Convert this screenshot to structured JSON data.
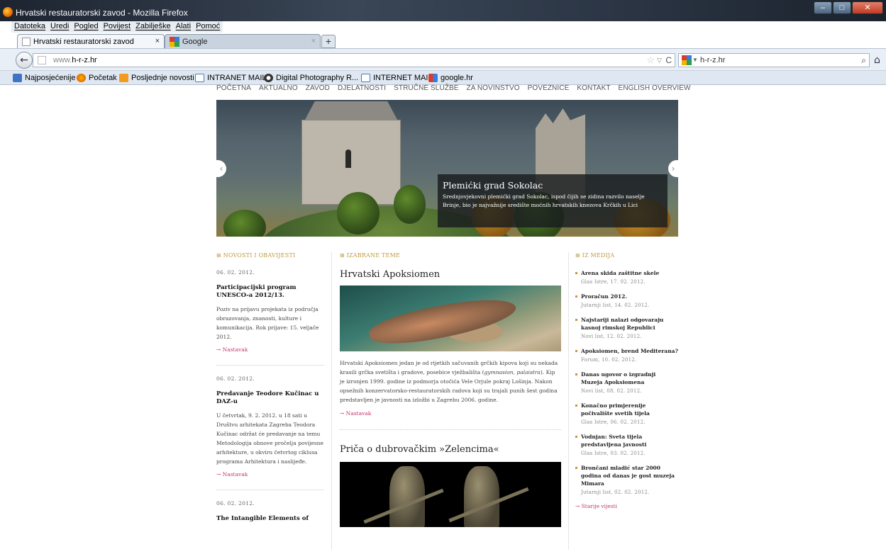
{
  "window": {
    "title": "Hrvatski restauratorski zavod - Mozilla Firefox"
  },
  "menu": [
    "Datoteka",
    "Uredi",
    "Pogled",
    "Povijest",
    "Zabilješke",
    "Alati",
    "Pomoć"
  ],
  "tabs": [
    {
      "label": "Hrvatski restauratorski zavod",
      "close": "×"
    },
    {
      "label": "Google",
      "close": "×"
    }
  ],
  "newtab": "+",
  "nav": {
    "url_prefix": "www.",
    "url_host": "h-r-z.hr",
    "search_value": "h-r-z.hr"
  },
  "bookmarks": [
    {
      "label": "Najposjećenije"
    },
    {
      "label": "Početak"
    },
    {
      "label": "Posljednje novosti"
    },
    {
      "label": "INTRANET MAIL"
    },
    {
      "label": "Digital Photography R..."
    },
    {
      "label": "INTERNET MAIL"
    },
    {
      "label": "google.hr"
    }
  ],
  "sitenav": [
    "POČETNA",
    "AKTUALNO",
    "ZAVOD",
    "DJELATNOSTI",
    "STRUČNE SLUŽBE",
    "ZA NOVINSTVO",
    "POVEZNICE",
    "KONTAKT",
    "ENGLISH OVERVIEW"
  ],
  "hero": {
    "caption_title": "Plemićki grad Sokolac",
    "caption_text": "Srednjovjekovni plemićki grad Sokolac, ispod čijih se zidina razvilo naselje Brinje, bio je najvažnije središte moćnih hrvatskih knezova Krčkih u Lici"
  },
  "sections": {
    "left": "NOVOSTI I OBAVIJESTI",
    "mid": "IZABRANE TEME",
    "right": "IZ MEDIJA"
  },
  "news": [
    {
      "date": "06. 02. 2012.",
      "title": "Participacijski program UNESCO-a 2012/13.",
      "body": "Poziv na prijavu projekata iz područja obrazovanja, znanosti, kulture i komunikacija. Rok prijave: 15. veljače 2012.",
      "more": "→ Nastavak"
    },
    {
      "date": "06. 02. 2012.",
      "title": "Predavanje Teodore Kučinac u DAZ-u",
      "body": "U četvrtak, 9. 2. 2012. u 18 sati u Društvu arhitekata Zagreba Teodora Kučinac održat će predavanje na temu Metodologija obnove pročelja povijesne arhitekture, u okviru četvrtog ciklusa programa Arhitektura i naslijeđe.",
      "more": "→ Nastavak"
    },
    {
      "date": "06. 02. 2012.",
      "title": "The Intangible Elements of",
      "body": "",
      "more": ""
    }
  ],
  "features": [
    {
      "title": "Hrvatski Apoksiomen",
      "body_1": "Hrvatski Apoksiomen jedan je od rijetkih sačuvanih grčkih kipova koji su nekada krasili grčka svetišta i gradove, posebice vježbališta (",
      "body_em1": "gymnasion",
      "body_2": ", ",
      "body_em2": "palaistra",
      "body_3": "). Kip je izronjen 1999. godine iz podmorja otočića Vele Orjule pokraj Lošinja. Nakon opsežnih konzervatorsko-restauratorskih radova koji su trajali punih šest godina predstavljen je javnosti na izložbi u Zagrebu 2006. godine.",
      "more": "→ Nastavak"
    },
    {
      "title": "Priča o dubrovačkim »Zelencima«"
    }
  ],
  "media": [
    {
      "title": "Arena skida zaštitne skele",
      "source": "Glas Istre, 17. 02. 2012."
    },
    {
      "title": "Proračun 2012.",
      "source": "Jutarnji list, 14. 02. 2012."
    },
    {
      "title": "Najstariji nalazi odgovaraju kasnoj rimskoj Republici",
      "source": "Novi list, 12. 02. 2012."
    },
    {
      "title": "Apoksiomen, brend Mediterana?",
      "source": "Forum, 10. 02. 2012."
    },
    {
      "title": "Danas ugovor o izgradnji Muzeja Apoksiomena",
      "source": "Novi list, 08. 02. 2012."
    },
    {
      "title": "Konačno primjerenije počivalište svetih tijela",
      "source": "Glas Istre, 06. 02. 2012."
    },
    {
      "title": "Vodnjan: Sveta tijela predstavljena javnosti",
      "source": "Glas Istre, 03. 02. 2012."
    },
    {
      "title": "Brončani mladić star 2000 godina od danas je gost muzeja Mimara",
      "source": "Jutarnji list, 02. 02. 2012."
    }
  ],
  "media_more": "→ Starije vijesti"
}
